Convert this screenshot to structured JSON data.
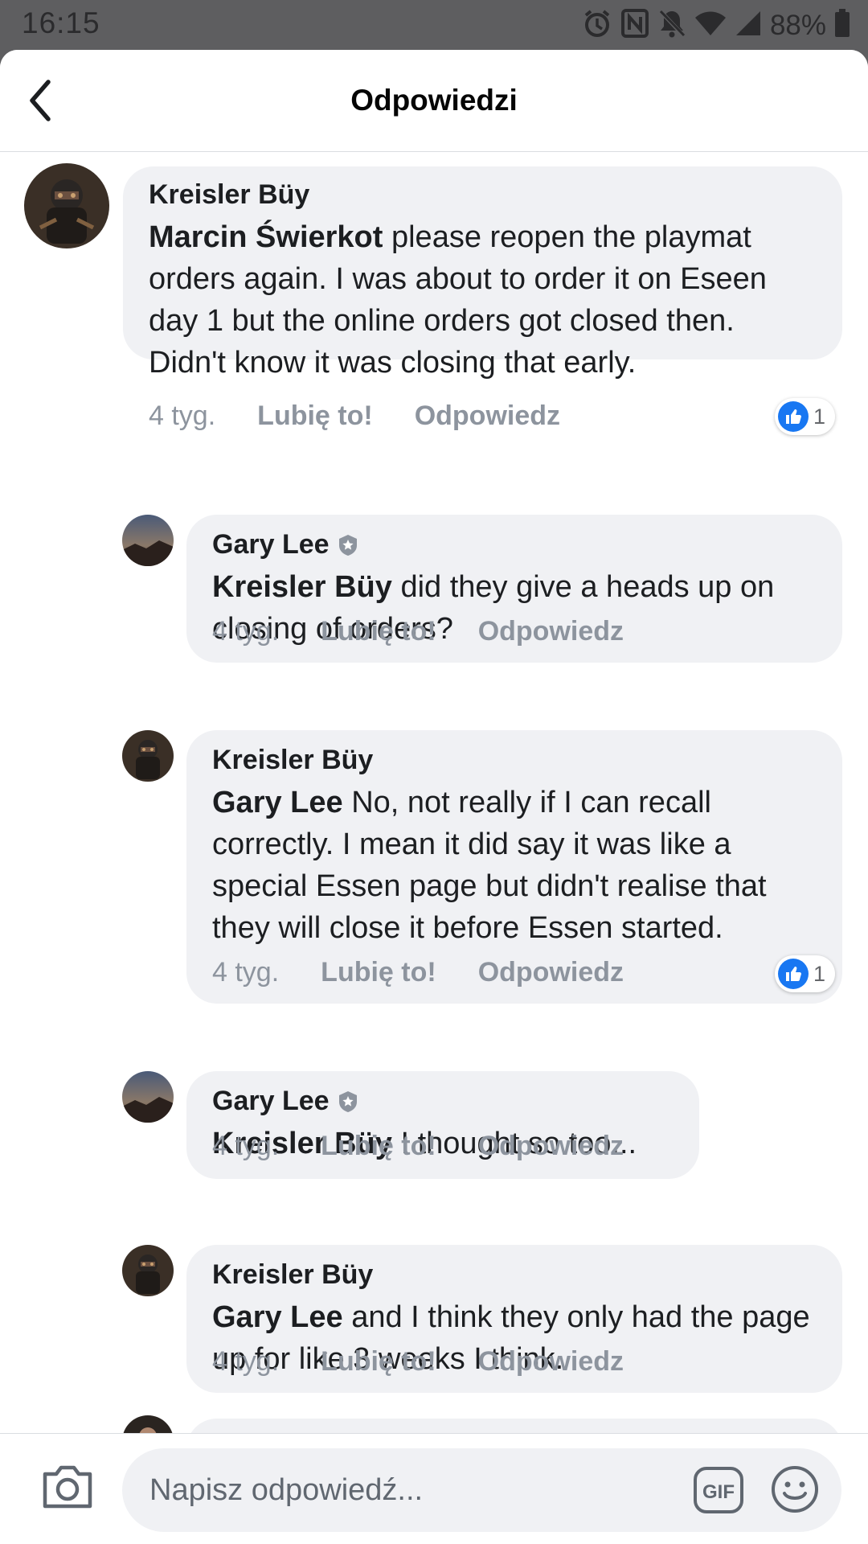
{
  "status_bar": {
    "time": "16:15",
    "battery": "88%"
  },
  "header": {
    "title": "Odpowiedzi"
  },
  "comments": [
    {
      "author": "Kreisler Büy",
      "mention": "Marcin Świerkot",
      "text": " please reopen the playmat orders again. I was about to order it on Eseen day 1 but the online orders got closed then. Didn't know it was closing that early.",
      "time": "4 tyg.",
      "like_label": "Lubię to!",
      "reply_label": "Odpowiedz",
      "reactions": "1"
    },
    {
      "author": "Gary Lee",
      "mention": "Kreisler Büy",
      "text": " did they give a heads up on closing of orders?",
      "time": "4 tyg.",
      "like_label": "Lubię to!",
      "reply_label": "Odpowiedz"
    },
    {
      "author": "Kreisler Büy",
      "mention": "Gary Lee",
      "text": " No, not really if I can recall correctly. I mean it did say it was like a special Essen page but didn't realise that they will close it before Essen started.",
      "time": "4 tyg.",
      "like_label": "Lubię to!",
      "reply_label": "Odpowiedz",
      "reactions": "1"
    },
    {
      "author": "Gary Lee",
      "mention": "Kreisler Büy",
      "text": " I thought so too...",
      "time": "4 tyg.",
      "like_label": "Lubię to!",
      "reply_label": "Odpowiedz"
    },
    {
      "author": "Kreisler Büy",
      "mention": "Gary Lee",
      "text": " and I think they only had the page up for like 3 weeks I think.",
      "time": "4 tyg.",
      "like_label": "Lubię to!",
      "reply_label": "Odpowiedz"
    }
  ],
  "composer": {
    "placeholder": "Napisz odpowiedź..."
  },
  "colors": {
    "like_blue": "#1877f2",
    "bubble_bg": "#f0f1f4",
    "meta_gray": "#8d949e"
  }
}
